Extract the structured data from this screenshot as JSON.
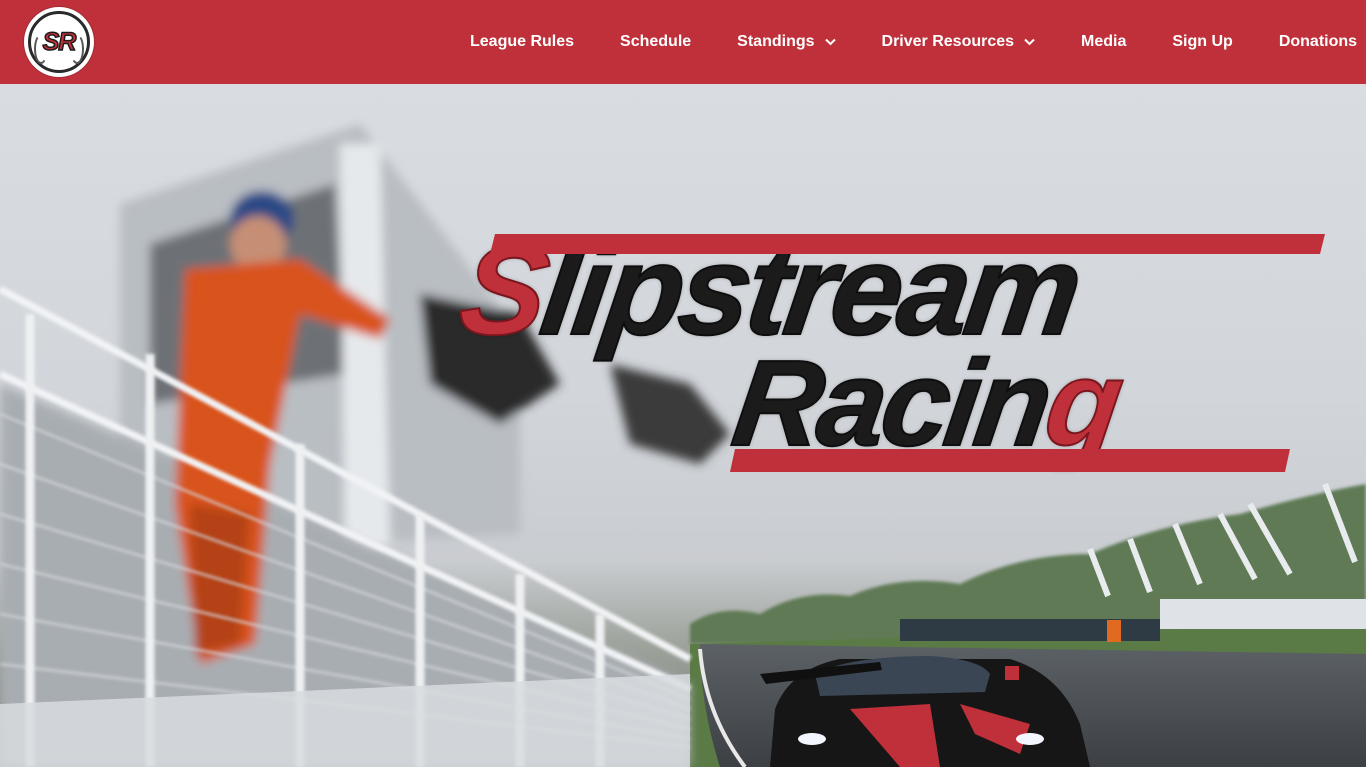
{
  "header": {
    "logo": {
      "text": "SR",
      "icon": "sr-laurel-logo"
    },
    "nav": [
      {
        "label": "League Rules",
        "has_dropdown": false
      },
      {
        "label": "Schedule",
        "has_dropdown": false
      },
      {
        "label": "Standings",
        "has_dropdown": true
      },
      {
        "label": "Driver Resources",
        "has_dropdown": true
      },
      {
        "label": "Media",
        "has_dropdown": false
      },
      {
        "label": "Sign Up",
        "has_dropdown": false
      },
      {
        "label": "Donations",
        "has_dropdown": false
      }
    ]
  },
  "hero": {
    "title_line_1": {
      "accent": "S",
      "rest": "lipstream"
    },
    "title_line_2": {
      "rest": "Racin",
      "accent": "g"
    }
  },
  "colors": {
    "header_bg": "#c0303a",
    "accent_red": "#c0303a",
    "title_black": "#1b1b1b",
    "nav_text": "#ffffff"
  }
}
